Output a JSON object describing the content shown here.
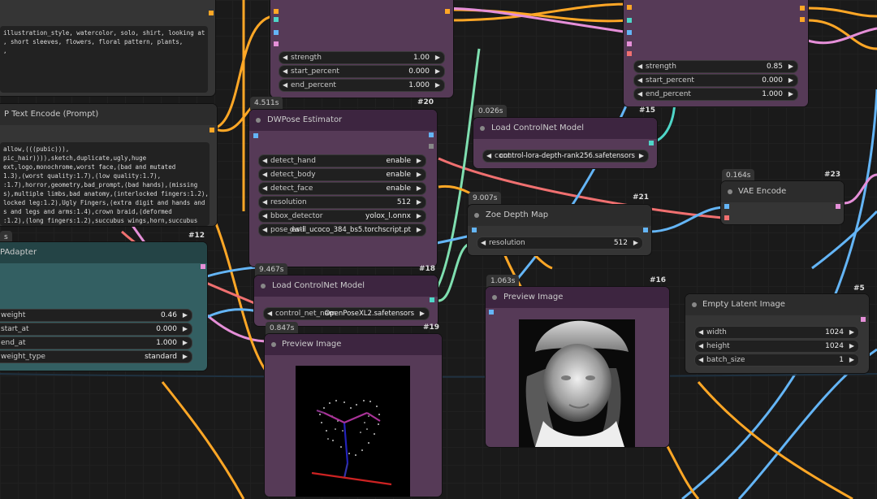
{
  "colors": {
    "canvas_bg": "#1a1a1a",
    "node_purple": "#563a57",
    "node_teal": "#335f62",
    "node_gray": "#353535",
    "slot_blue": "#64b5f6",
    "slot_orange": "#ffa726",
    "slot_green": "#7fdfb0",
    "slot_pink": "#e58fd8",
    "slot_red": "#f07070",
    "slot_teal": "#4fd6c8"
  },
  "nodes": {
    "prompt_top": {
      "text": "illustration_style, watercolor, solo, shirt, looking at\n, short sleeves, flowers, floral pattern, plants,\n,"
    },
    "clip_text_encode": {
      "title": "P Text Encode (Prompt)",
      "text": "allow,(((pubic))),\npic_hair)))),sketch,duplicate,ugly,huge\next,logo,monochrome,worst face,(bad and mutated\n1.3),(worst quality:1.7),(low quality:1.7),\n:1.7),horror,geometry,bad_prompt,(bad hands),(missing\ns),multiple limbs,bad anatomy,(interlocked fingers:1.2),\nlocked leg:1.2),Ugly Fingers,(extra digit and hands and\ns and legs and arms:1.4),crown braid,(deformed\n:1.2),(long fingers:1.2),succubus wings,horn,succubus\nuccubus hairstyle,(bad-artist-anime),bad-artist,bad"
    },
    "ipadapter": {
      "timing": "s",
      "id": "#12",
      "title": "PAdapter",
      "weight_label": "weight",
      "weight_value": "0.46",
      "start_label": "start_at",
      "start_value": "0.000",
      "end_label": "end_at",
      "end_value": "1.000",
      "type_label": "weight_type",
      "type_value": "standard"
    },
    "controlnet_apply_a": {
      "strength_label": "strength",
      "strength_value": "1.00",
      "start_label": "start_percent",
      "start_value": "0.000",
      "end_label": "end_percent",
      "end_value": "1.000"
    },
    "controlnet_apply_b": {
      "strength_label": "strength",
      "strength_value": "0.85",
      "start_label": "start_percent",
      "start_value": "0.000",
      "end_label": "end_percent",
      "end_value": "1.000"
    },
    "dwpose": {
      "timing": "4.511s",
      "id": "#20",
      "title": "DWPose Estimator",
      "detect_hand_label": "detect_hand",
      "detect_hand_value": "enable",
      "detect_body_label": "detect_body",
      "detect_body_value": "enable",
      "detect_face_label": "detect_face",
      "detect_face_value": "enable",
      "resolution_label": "resolution",
      "resolution_value": "512",
      "bbox_label": "bbox_detector",
      "bbox_value": "yolox_l.onnx",
      "pose_label": "pose_esti",
      "pose_value": "dw-ll_ucoco_384_bs5.torchscript.pt"
    },
    "load_controlnet_15": {
      "timing": "0.026s",
      "id": "#15",
      "title": "Load ControlNet Model",
      "label": "cont",
      "value": "control-lora-depth-rank256.safetensors"
    },
    "zoe_depth": {
      "timing": "9.007s",
      "id": "#21",
      "title": "Zoe Depth Map",
      "resolution_label": "resolution",
      "resolution_value": "512"
    },
    "vae_encode": {
      "timing": "0.164s",
      "id": "#23",
      "title": "VAE Encode"
    },
    "load_controlnet_18": {
      "timing": "9.467s",
      "id": "#18",
      "title": "Load ControlNet Model",
      "label": "control_net_nam",
      "value": "OpenPoseXL2.safetensors"
    },
    "preview_19": {
      "timing": "0.847s",
      "id": "#19",
      "title": "Preview Image"
    },
    "preview_16": {
      "timing": "1.063s",
      "id": "#16",
      "title": "Preview Image"
    },
    "empty_latent": {
      "id": "#5",
      "title": "Empty Latent Image",
      "width_label": "width",
      "width_value": "1024",
      "height_label": "height",
      "height_value": "1024",
      "batch_label": "batch_size",
      "batch_value": "1"
    }
  }
}
